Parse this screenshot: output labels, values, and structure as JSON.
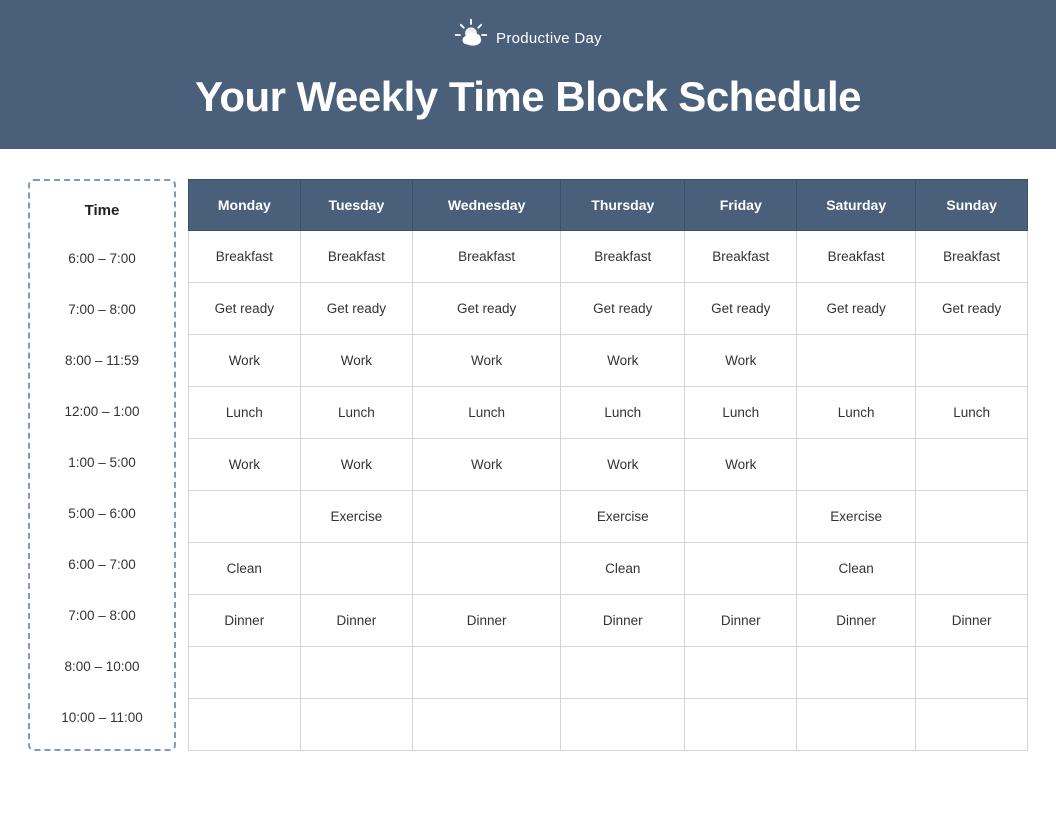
{
  "brand": {
    "icon": "☀️",
    "label": "Productive Day"
  },
  "title": "Your Weekly Time Block Schedule",
  "timeSlots": [
    "6:00 – 7:00",
    "7:00 – 8:00",
    "8:00 – 11:59",
    "12:00 – 1:00",
    "1:00 – 5:00",
    "5:00 – 6:00",
    "6:00 – 7:00",
    "7:00 – 8:00",
    "8:00 – 10:00",
    "10:00 – 11:00"
  ],
  "timeColHeader": "Time",
  "days": [
    "Monday",
    "Tuesday",
    "Wednesday",
    "Thursday",
    "Friday",
    "Saturday",
    "Sunday"
  ],
  "schedule": [
    [
      "Breakfast",
      "Breakfast",
      "Breakfast",
      "Breakfast",
      "Breakfast",
      "Breakfast",
      "Breakfast"
    ],
    [
      "Get ready",
      "Get ready",
      "Get ready",
      "Get ready",
      "Get ready",
      "Get ready",
      "Get ready"
    ],
    [
      "Work",
      "Work",
      "Work",
      "Work",
      "Work",
      "",
      ""
    ],
    [
      "Lunch",
      "Lunch",
      "Lunch",
      "Lunch",
      "Lunch",
      "Lunch",
      "Lunch"
    ],
    [
      "Work",
      "Work",
      "Work",
      "Work",
      "Work",
      "",
      ""
    ],
    [
      "",
      "Exercise",
      "",
      "Exercise",
      "",
      "Exercise",
      ""
    ],
    [
      "Clean",
      "",
      "",
      "Clean",
      "",
      "Clean",
      ""
    ],
    [
      "Dinner",
      "Dinner",
      "Dinner",
      "Dinner",
      "Dinner",
      "Dinner",
      "Dinner"
    ],
    [
      "",
      "",
      "",
      "",
      "",
      "",
      ""
    ],
    [
      "",
      "",
      "",
      "",
      "",
      "",
      ""
    ]
  ]
}
